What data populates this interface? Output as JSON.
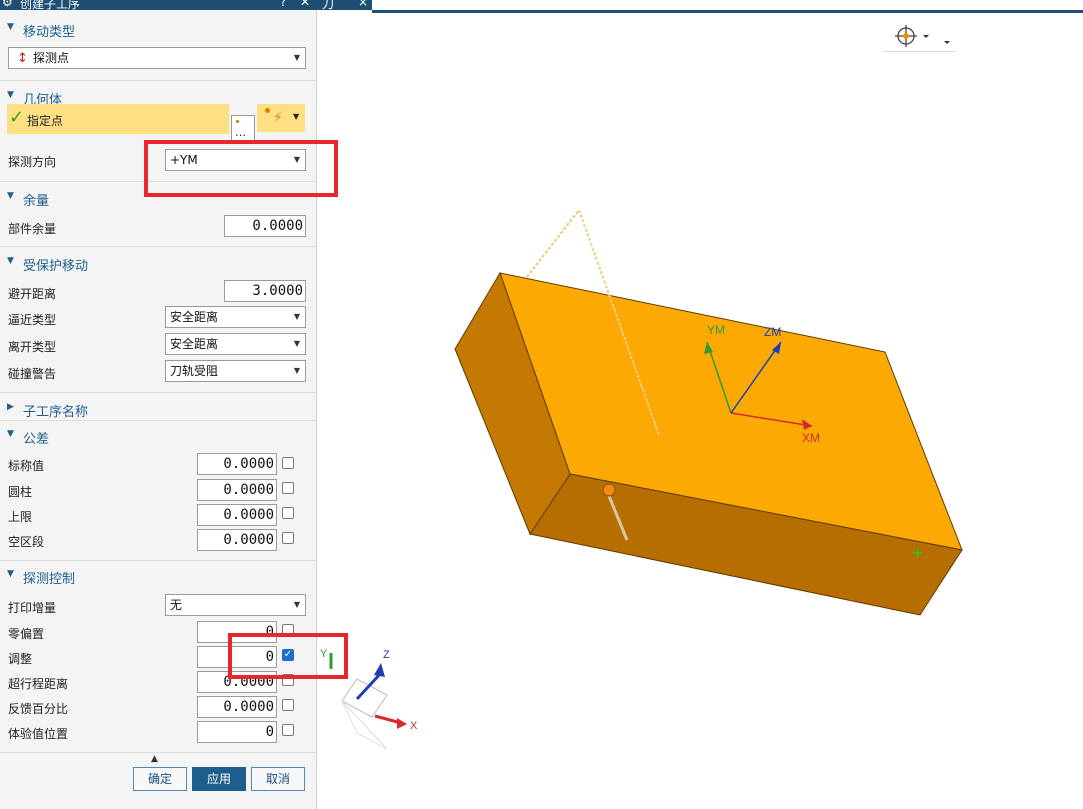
{
  "titlebar": {
    "title": "创建子工序",
    "help": "?",
    "close": "✕",
    "tab_label": "刀"
  },
  "sections": {
    "move_type": {
      "header": "移动类型",
      "value": "探测点"
    },
    "geometry": {
      "header": "几何体",
      "specify_point": "指定点",
      "probe_dir_label": "探测方向",
      "probe_dir_value": "+YM"
    },
    "stock": {
      "header": "余量",
      "part_stock_label": "部件余量",
      "part_stock_value": "0.0000"
    },
    "protected": {
      "header": "受保护移动",
      "clearance_label": "避开距离",
      "clearance_value": "3.0000",
      "approach_label": "逼近类型",
      "approach_value": "安全距离",
      "depart_label": "离开类型",
      "depart_value": "安全距离",
      "collision_label": "碰撞警告",
      "collision_value": "刀轨受阻"
    },
    "sub_name": {
      "header": "子工序名称"
    },
    "tolerance": {
      "header": "公差",
      "rows": [
        {
          "label": "标称值",
          "value": "0.0000"
        },
        {
          "label": "圆柱",
          "value": "0.0000"
        },
        {
          "label": "上限",
          "value": "0.0000"
        },
        {
          "label": "空区段",
          "value": "0.0000"
        }
      ]
    },
    "probe_ctrl": {
      "header": "探测控制",
      "print_inc_label": "打印增量",
      "print_inc_value": "无",
      "rows": [
        {
          "label": "零偏置",
          "value": "0"
        },
        {
          "label": "调整",
          "value": "0"
        },
        {
          "label": "超行程距离",
          "value": "0.0000"
        },
        {
          "label": "反馈百分比",
          "value": "0.0000"
        },
        {
          "label": "体验值位置",
          "value": "0"
        }
      ]
    }
  },
  "footer": {
    "ok": "确定",
    "apply": "应用",
    "cancel": "取消"
  },
  "viewport": {
    "axes": {
      "xm": "XM",
      "ym": "YM",
      "zm": "ZM"
    },
    "triad": {
      "x": "X",
      "y": "Y",
      "z": "Z"
    }
  },
  "colors": {
    "accent": "#1d5e8c",
    "block_top": "#fcaa03",
    "block_side": "#b66e00",
    "highlight": "#e8262c"
  }
}
